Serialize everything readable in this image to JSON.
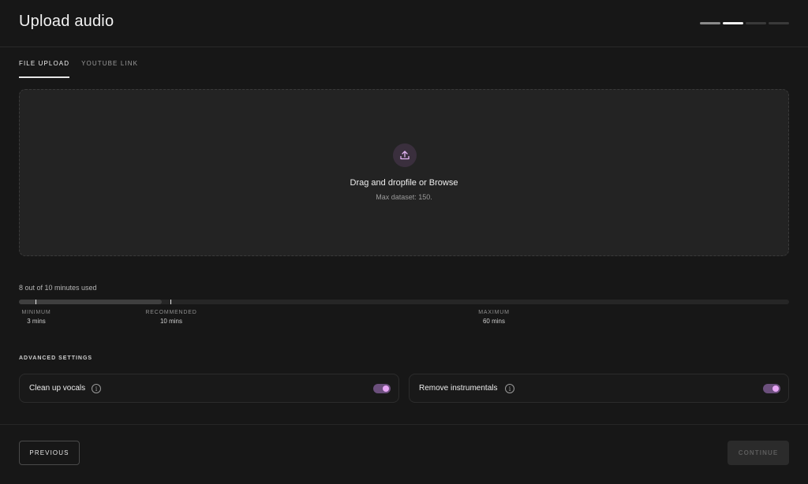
{
  "header": {
    "title": "Upload audio",
    "steps": {
      "total": 4,
      "current": 2
    }
  },
  "tabs": [
    {
      "label": "FILE UPLOAD",
      "active": true
    },
    {
      "label": "YOUTUBE LINK",
      "active": false
    }
  ],
  "dropzone": {
    "icon": "upload-icon",
    "title": "Drag and dropfile or Browse",
    "subtitle": "Max dataset: 150."
  },
  "usage": {
    "text": "8 out of 10 minutes used",
    "used_minutes": 8,
    "scale_max_minutes": 60,
    "markers": [
      {
        "label": "MINIMUM",
        "value": "3 mins"
      },
      {
        "label": "RECOMMENDED",
        "value": "10 mins"
      },
      {
        "label": "MAXIMUM",
        "value": "60 mins"
      }
    ]
  },
  "advanced": {
    "label": "ADVANCED SETTINGS",
    "settings": [
      {
        "label": "Clean up vocals",
        "enabled": true,
        "info_icon": "info-icon"
      },
      {
        "label": "Remove instrumentals",
        "enabled": true,
        "info_icon": "info-icon"
      }
    ]
  },
  "footer": {
    "previous_label": "PREVIOUS",
    "continue_label": "CONTINUE",
    "continue_disabled": true
  },
  "colors": {
    "background": "#171717",
    "accent": "#e8a6f5",
    "toggle_track": "#6b4f7c"
  }
}
